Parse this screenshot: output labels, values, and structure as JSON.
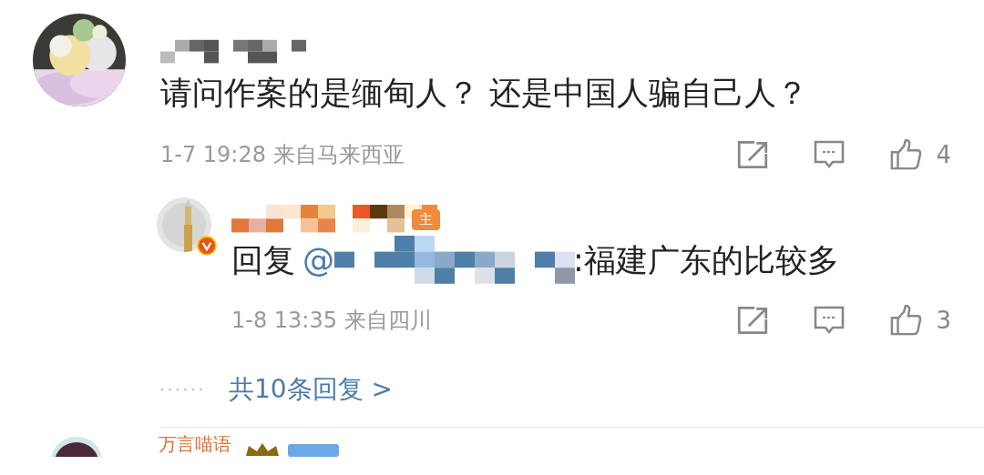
{
  "comments": [
    {
      "text": "请问作案的是缅甸人？ 还是中国人骗自己人？",
      "time": "1-7 19:28",
      "location": "来自马来西亚",
      "likes": "4",
      "reply": {
        "badge": "主",
        "verified": true,
        "prefix": "回复",
        "mention": "@",
        "text": ":福建广东的比较多",
        "time": "1-8 13:35",
        "location": "来自四川",
        "likes": "3"
      },
      "more_replies": "共10条回复 >"
    }
  ],
  "next_comment": {
    "name": "万言喵语"
  }
}
